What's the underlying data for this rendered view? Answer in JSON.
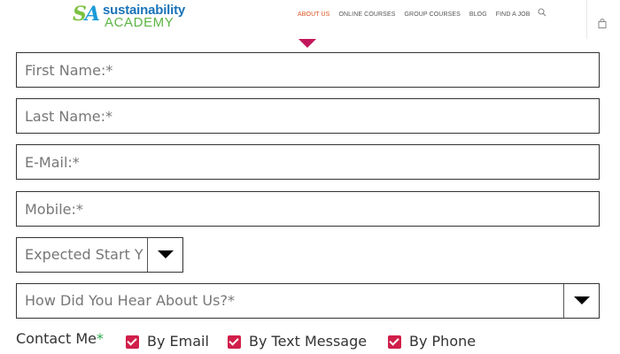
{
  "header": {
    "logo": {
      "mark_s": "S",
      "mark_a": "A",
      "line1": "sustainability",
      "line2": "ACADEMY"
    },
    "nav": [
      {
        "label": "ABOUT US",
        "active": true
      },
      {
        "label": "ONLINE COURSES",
        "active": false
      },
      {
        "label": "GROUP COURSES",
        "active": false
      },
      {
        "label": "BLOG",
        "active": false
      },
      {
        "label": "FIND A JOB",
        "active": false
      }
    ],
    "search_icon": "search-icon",
    "cart_icon": "shopping-bag-icon",
    "active_color": "#d9531e",
    "marker_color": "#c2185b"
  },
  "form": {
    "first_name": {
      "value": "",
      "placeholder": "First Name:*"
    },
    "last_name": {
      "value": "",
      "placeholder": "Last Name:*"
    },
    "email": {
      "value": "",
      "placeholder": "E-Mail:*"
    },
    "mobile": {
      "value": "",
      "placeholder": "Mobile:*"
    },
    "expected_start": {
      "selected": "Expected Start Y"
    },
    "how_heard": {
      "selected": "How Did You Hear About Us?*"
    },
    "contact": {
      "label": "Contact Me",
      "required_mark": "*",
      "options": [
        {
          "label": "By Email",
          "checked": true
        },
        {
          "label": "By Text Message",
          "checked": true
        },
        {
          "label": "By Phone",
          "checked": true
        }
      ],
      "checkbox_color": "#d01f4a"
    }
  }
}
